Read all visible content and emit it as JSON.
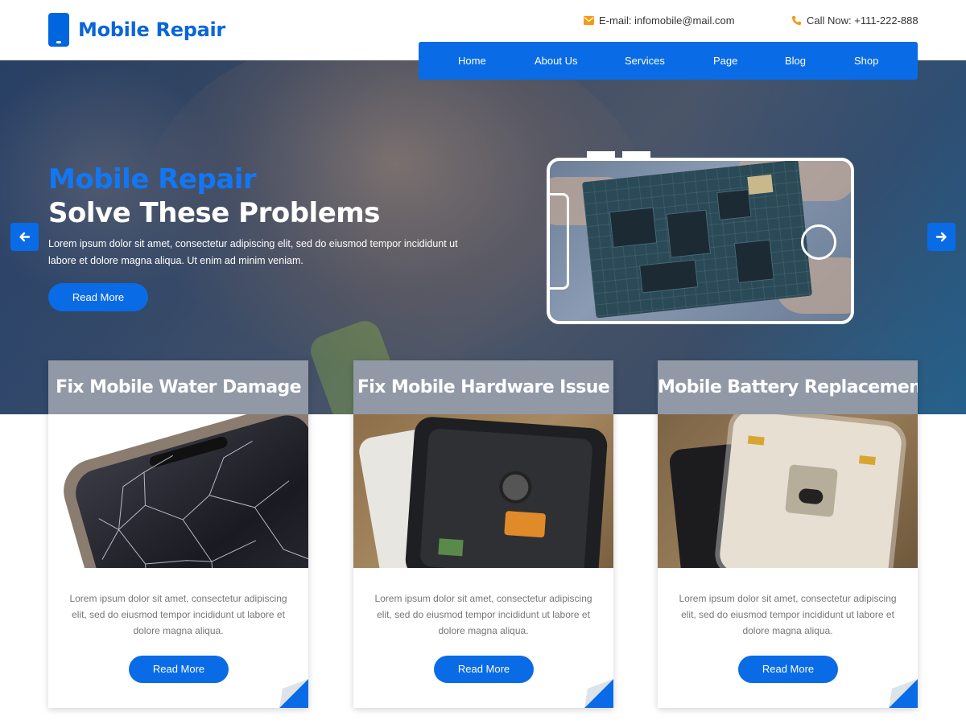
{
  "header": {
    "logo_text": "Mobile Repair",
    "email": "E-mail: infomobile@mail.com",
    "phone": "Call Now: +111-222-888"
  },
  "nav": {
    "items": [
      "Home",
      "About Us",
      "Services",
      "Page",
      "Blog",
      "Shop"
    ]
  },
  "hero": {
    "title_line1": "Mobile Repair",
    "title_line2": "Solve These Problems",
    "description": "Lorem ipsum dolor sit amet, consectetur adipiscing elit, sed do eiusmod tempor incididunt ut labore et dolore magna aliqua. Ut enim ad minim veniam.",
    "button": "Read More"
  },
  "cards": [
    {
      "title": "Fix Mobile Water Damage",
      "text": "Lorem ipsum dolor sit amet, consectetur adipiscing elit, sed do eiusmod tempor incididunt ut labore et dolore magna aliqua.",
      "button": "Read More"
    },
    {
      "title": "Fix Mobile Hardware Issue",
      "text": "Lorem ipsum dolor sit amet, consectetur adipiscing elit, sed do eiusmod tempor incididunt ut labore et dolore magna aliqua.",
      "button": "Read More"
    },
    {
      "title": "Mobile Battery Replacement",
      "text": "Lorem ipsum dolor sit amet, consectetur adipiscing elit, sed do eiusmod tempor incididunt ut labore et dolore magna aliqua.",
      "button": "Read More"
    }
  ],
  "colors": {
    "accent": "#0a6be6",
    "logo": "#0a66d8",
    "contact_icon": "#f39c12",
    "hero_title_accent": "#1277f5"
  },
  "icons": {
    "email": "envelope-icon",
    "phone": "phone-icon",
    "slider_prev": "arrow-left-icon",
    "slider_next": "arrow-right-icon"
  }
}
